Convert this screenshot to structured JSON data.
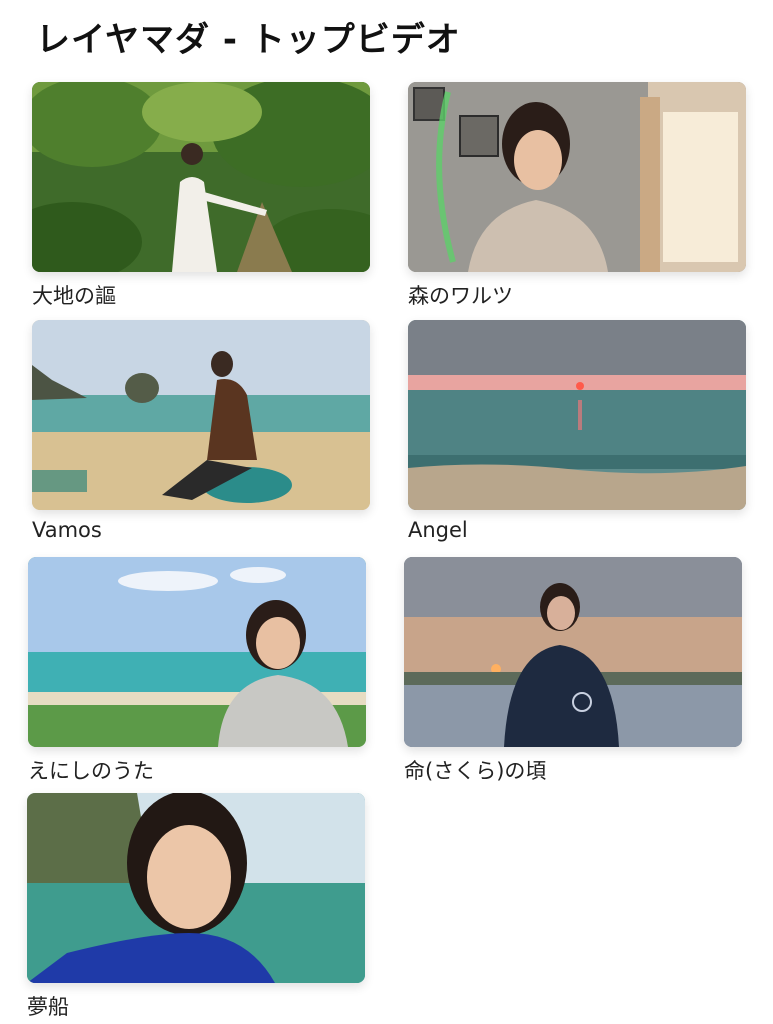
{
  "page": {
    "title": "レイヤマダ - トップビデオ"
  },
  "videos": [
    {
      "title": "大地の謳",
      "scene": "jungle-icon"
    },
    {
      "title": "森のワルツ",
      "scene": "room-icon"
    },
    {
      "title": "Vamos",
      "scene": "beach-rocks-icon"
    },
    {
      "title": "Angel",
      "scene": "sunset-sea-icon"
    },
    {
      "title": "えにしのうた",
      "scene": "seaside-icon"
    },
    {
      "title": "命(さくら)の頃",
      "scene": "dusk-shore-icon"
    },
    {
      "title": "夢船",
      "scene": "cove-icon"
    }
  ]
}
